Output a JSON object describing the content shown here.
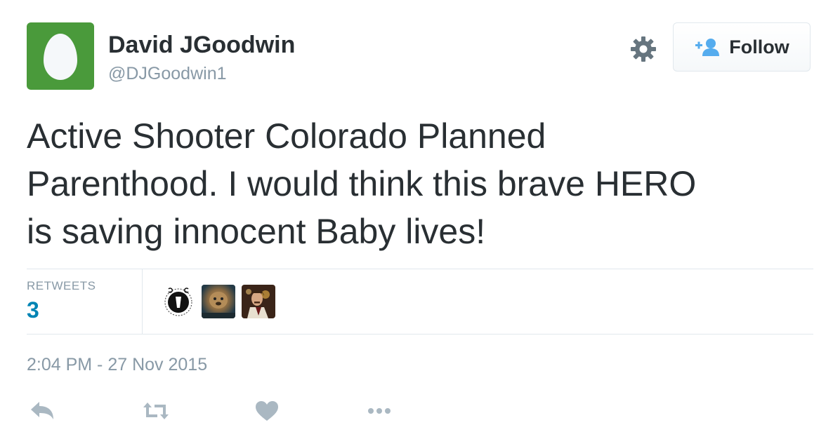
{
  "user": {
    "name": "David JGoodwin",
    "handle": "@DJGoodwin1",
    "avatar_color": "#4a9a3b",
    "avatar_icon": "egg-icon"
  },
  "header": {
    "settings_icon": "gear-icon",
    "follow_label": "Follow",
    "follow_icon": "add-user-icon"
  },
  "tweet": {
    "text": "Active Shooter Colorado Planned\nParenthood.  I would think this brave HERO\nis saving innocent Baby lives!"
  },
  "stats": {
    "retweets_label": "RETWEETS",
    "retweets_count": "3",
    "retweeter_avatars": [
      "retweeter-avatar-1",
      "retweeter-avatar-2",
      "retweeter-avatar-3"
    ]
  },
  "timestamp": "2:04 PM - 27 Nov 2015",
  "actions": [
    "reply-icon",
    "retweet-icon",
    "like-icon",
    "more-icon"
  ],
  "colors": {
    "text": "#292f33",
    "muted": "#8899a6",
    "link": "#0084b4",
    "follow_icon": "#55acee"
  }
}
